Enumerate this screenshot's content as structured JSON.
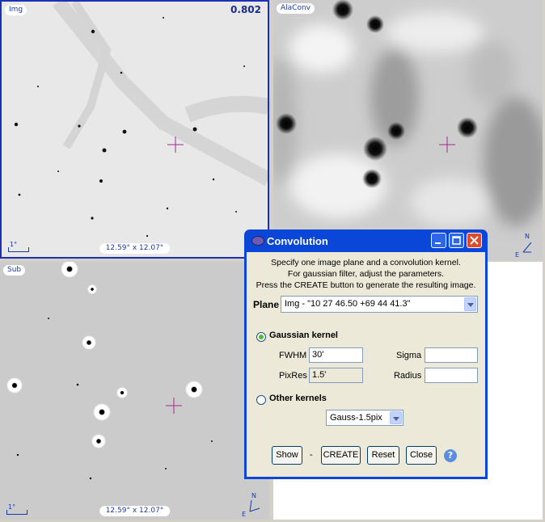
{
  "views": {
    "img": {
      "label": "Img",
      "zoom": "0.802",
      "scale": "1°",
      "size": "12.59° x 12.07°"
    },
    "conv": {
      "label": "AlaConv"
    },
    "sub": {
      "label": "Sub",
      "scale": "1°",
      "size": "12.59° x 12.07°"
    }
  },
  "compass": {
    "north": "N",
    "east": "E"
  },
  "dialog": {
    "title": "Convolution",
    "info_line1": "Specify one image plane and a convolution kernel.",
    "info_line2": "For gaussian filter, adjust the parameters.",
    "info_line3": "Press the CREATE button to generate the resulting image.",
    "plane_label": "Plane",
    "plane_value": "Img - \"10 27 46.50 +69 44 41.3\"",
    "gaussian_label": "Gaussian kernel",
    "fwhm_label": "FWHM",
    "fwhm_value": "30'",
    "pixres_label": "PixRes",
    "pixres_value": "1.5'",
    "sigma_label": "Sigma",
    "sigma_value": "",
    "radius_label": "Radius",
    "radius_value": "",
    "other_label": "Other kernels",
    "kernel_value": "Gauss-1.5pix",
    "buttons": {
      "show": "Show",
      "dash": "-",
      "create": "CREATE",
      "reset": "Reset",
      "close": "Close"
    },
    "help": "?"
  }
}
